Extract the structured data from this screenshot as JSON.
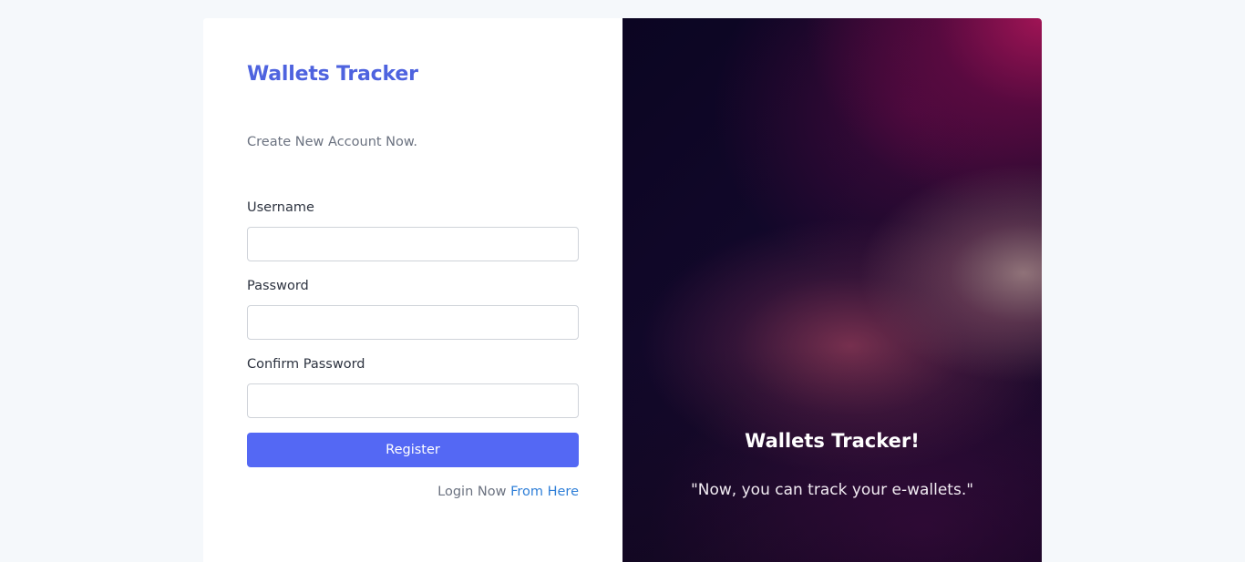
{
  "brand": {
    "title": "Wallets Tracker"
  },
  "form": {
    "subtitle": "Create New Account Now.",
    "fields": [
      {
        "label": "Username",
        "value": "",
        "placeholder": ""
      },
      {
        "label": "Password",
        "value": "",
        "placeholder": ""
      },
      {
        "label": "Confirm Password",
        "value": "",
        "placeholder": ""
      }
    ],
    "submit_label": "Register",
    "login_prompt": "Login Now",
    "login_link": "From Here"
  },
  "hero": {
    "title": "Wallets Tracker!",
    "quote": "\"Now, you can track your e-wallets.\""
  },
  "colors": {
    "accent": "#5468f4",
    "brand": "#4e63df",
    "link": "#2f7fd8",
    "page_background": "#f5f8fb"
  }
}
